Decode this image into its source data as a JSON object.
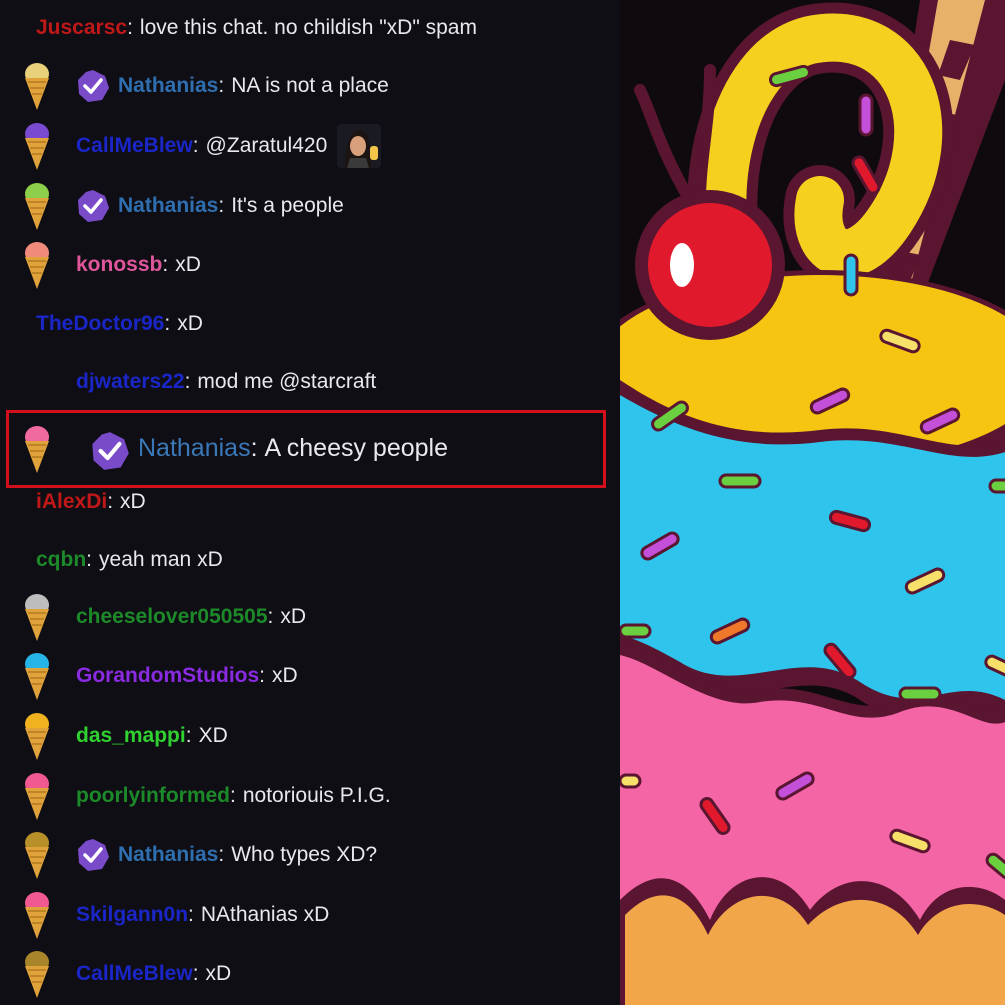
{
  "chat": {
    "messages": [
      {
        "user": "Juscarsc",
        "user_color": "#c01818",
        "text": "love this chat. no childish \"xD\" spam",
        "cone": null,
        "badge": false,
        "emote": false
      },
      {
        "user": "Nathanias",
        "user_color": "#2f6fb0",
        "text": "NA is not a place",
        "cone": "#e9d07a",
        "badge": true,
        "emote": false
      },
      {
        "user": "CallMeBlew",
        "user_color": "#1a26c8",
        "text": "@Zaratul420",
        "cone": "#7a4bd1",
        "badge": false,
        "emote": true
      },
      {
        "user": "Nathanias",
        "user_color": "#2f6fb0",
        "text": "It's a people",
        "cone": "#8ccf4a",
        "badge": true,
        "emote": false
      },
      {
        "user": "konossb",
        "user_color": "#e0569c",
        "text": "xD",
        "cone": "#f08a7a",
        "badge": false,
        "emote": false
      },
      {
        "user": "TheDoctor96",
        "user_color": "#1a26c8",
        "text": "xD",
        "cone": null,
        "badge": false,
        "emote": false
      },
      {
        "user": "djwaters22",
        "user_color": "#1a26c8",
        "text": "mod me @starcraft",
        "cone": null,
        "badge": false,
        "emote": false
      },
      {
        "user": "Nathanias",
        "user_color": "#3a78b8",
        "text": "A cheesy people",
        "cone": "#f06aa0",
        "badge": true,
        "emote": false
      },
      {
        "user": "iAlexDi",
        "user_color": "#c01818",
        "text": "xD",
        "cone": null,
        "badge": false,
        "emote": false
      },
      {
        "user": "cqbn",
        "user_color": "#1d8a2a",
        "text": "yeah man xD",
        "cone": null,
        "badge": false,
        "emote": false
      },
      {
        "user": "cheeselover050505",
        "user_color": "#1d8a2a",
        "text": "xD",
        "cone": "#bdbdbd",
        "badge": false,
        "emote": false
      },
      {
        "user": "GorandomStudios",
        "user_color": "#8a2be2",
        "text": "xD",
        "cone": "#27b5e8",
        "badge": false,
        "emote": false
      },
      {
        "user": "das_mappi",
        "user_color": "#2fd02f",
        "text": "XD",
        "cone": "#f0b21e",
        "badge": false,
        "emote": false
      },
      {
        "user": "poorlyinformed",
        "user_color": "#1d8a2a",
        "text": "notoriouis P.I.G.",
        "cone": "#f05a90",
        "badge": false,
        "emote": false
      },
      {
        "user": "Nathanias",
        "user_color": "#2f6fb0",
        "text": "Who types XD?",
        "cone": "#b8902a",
        "badge": true,
        "emote": false
      },
      {
        "user": "Skilgann0n",
        "user_color": "#1a26c8",
        "text": "NAthanias xD",
        "cone": "#f05a90",
        "badge": false,
        "emote": false
      },
      {
        "user": "CallMeBlew",
        "user_color": "#1a26c8",
        "text": "xD",
        "cone": "#a8842a",
        "badge": false,
        "emote": false
      }
    ],
    "highlighted_index": 7,
    "colon": ":"
  },
  "colors": {
    "chat_bg": "#0f0e14",
    "highlight": "#d1101c",
    "badge": "#7a4bc9"
  },
  "icons": {
    "badge": "verified-check-icon",
    "cone": "ice-cream-cone-icon",
    "emote": "waving-emote-icon"
  }
}
